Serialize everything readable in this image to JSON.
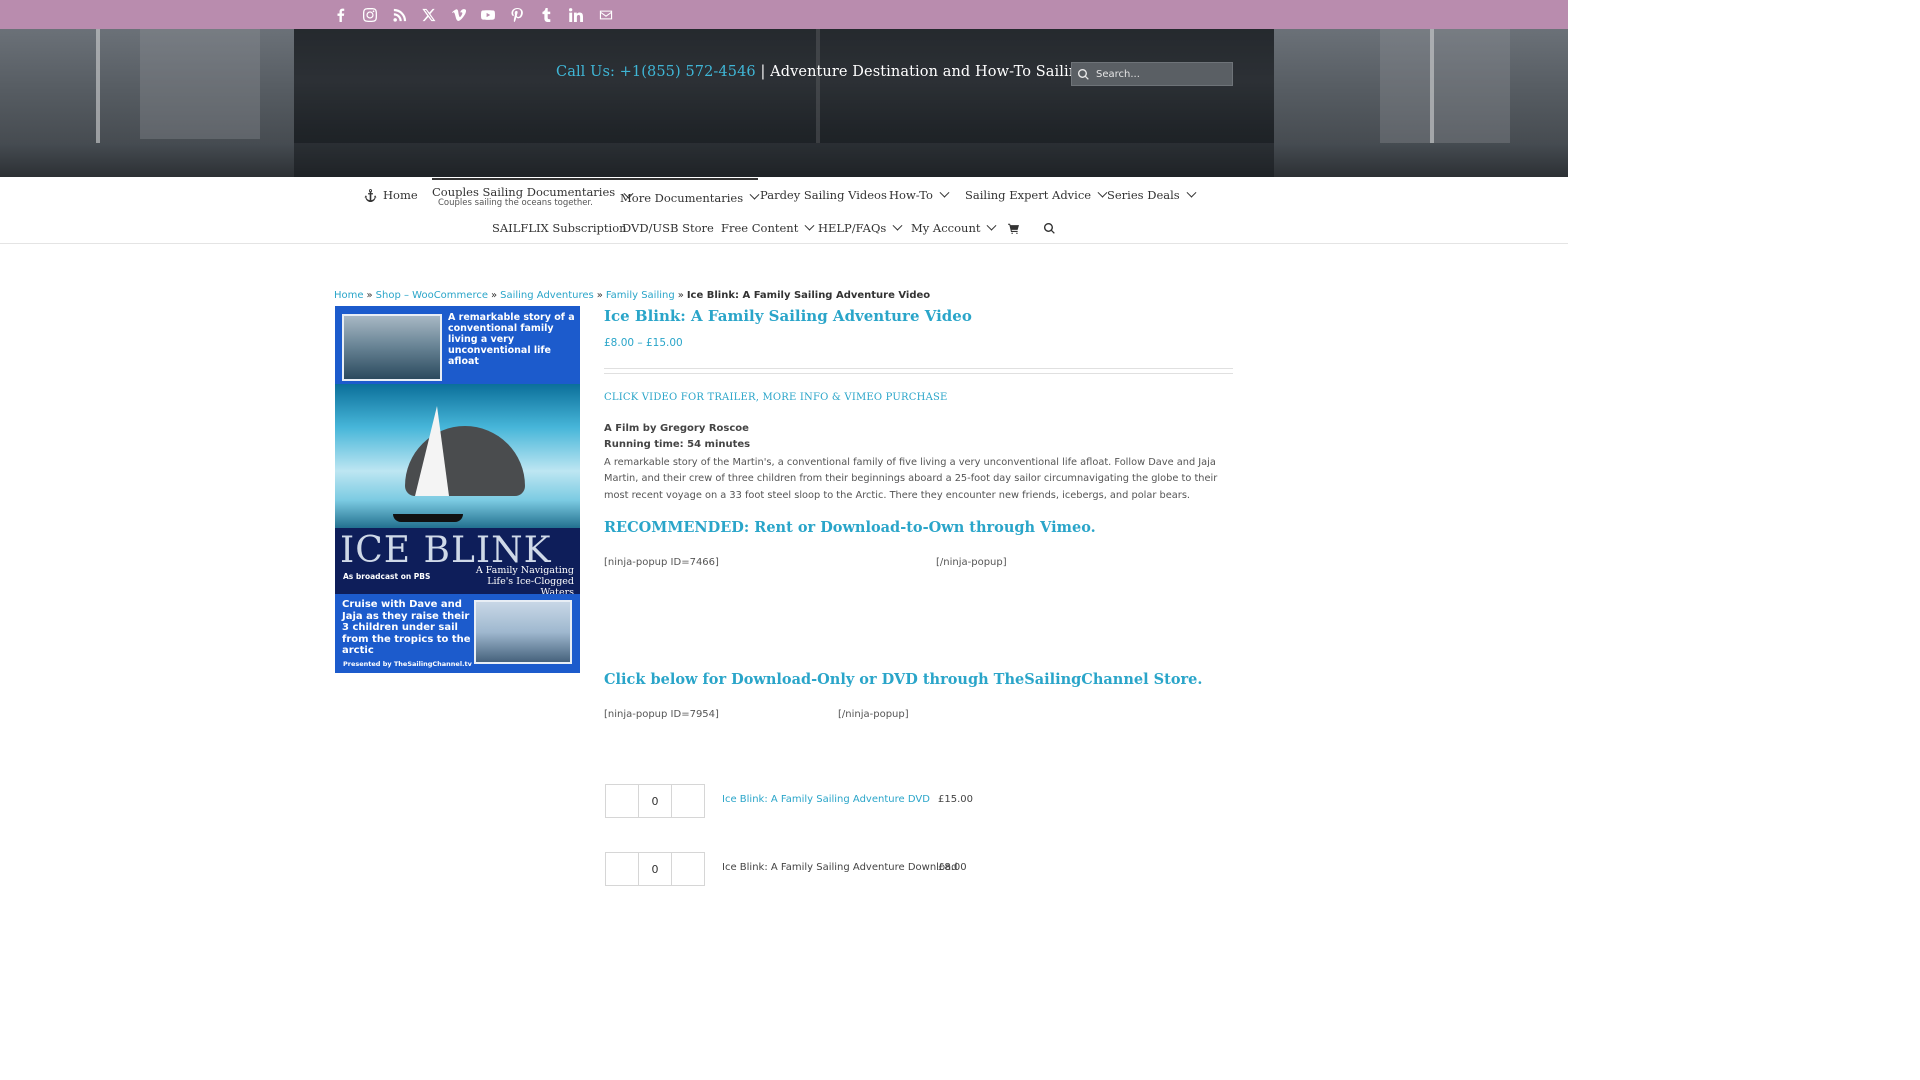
{
  "social": [
    "facebook-icon",
    "instagram-icon",
    "rss-icon",
    "x-twitter-icon",
    "vimeo-icon",
    "youtube-icon",
    "pinterest-icon",
    "tumblr-icon",
    "linkedin-icon",
    "email-icon"
  ],
  "header": {
    "call_label": "Call Us: +1(855) 572-4546",
    "tagline": " | Adventure Destination and How-To Sailing Videos",
    "search_placeholder": "Search..."
  },
  "nav": {
    "home": "Home",
    "couples": "Couples Sailing Documentaries",
    "couples_sub": "Couples sailing the oceans together.",
    "more_docs": "More Documentaries",
    "pardey": "Pardey Sailing Videos",
    "howto": "How-To",
    "expert": "Sailing Expert Advice",
    "series": "Series Deals",
    "sailflix": "SAILFLIX Subscription",
    "dvd": "DVD/USB Store",
    "free": "Free Content",
    "help": "HELP/FAQs",
    "account": "My Account"
  },
  "breadcrumb": {
    "home": "Home",
    "shop": "Shop – WooCommerce",
    "adventures": "Sailing Adventures",
    "family": "Family Sailing",
    "current": "Ice Blink: A Family Sailing Adventure Video",
    "separator": "»"
  },
  "cover": {
    "top_text": "A remarkable story of a conventional family living a very unconventional life afloat",
    "title": "ICE BLINK",
    "broadcast": "As broadcast on PBS",
    "subtitle": "A Family Navigating Life's Ice-Clogged Waters",
    "bottom_text": "Cruise with Dave and Jaja as they raise their 3 children under sail from the tropics to the arctic",
    "presented": "Presented by TheSailingChannel.tv"
  },
  "product": {
    "title": "Ice Blink: A Family Sailing Adventure Video",
    "price": "£8.00 – £15.00",
    "click_video": "CLICK VIDEO FOR TRAILER, MORE INFO & VIMEO PURCHASE",
    "film_by": "A Film by Gregory Roscoe",
    "running_time": "Running time: 54 minutes",
    "description": "A remarkable story of the Martin's, a conventional family of five living a very unconventional life afloat. Follow Dave and Jaja Martin, and their crew of three children from their beginnings aboard a 25-foot day sailor circumnavigating the globe to their most recent voyage on a 33 foot steel sloop to the Arctic. There they encounter new friends, icebergs, and polar bears.",
    "recommended": "RECOMMENDED: Rent or Download-to-Own through Vimeo.",
    "popup1_open": "[ninja-popup ID=7466]",
    "popup1_close": "[/ninja-popup]",
    "download_heading": "Click below for Download-Only or DVD through TheSailingChannel Store.",
    "popup2_open": "[ninja-popup ID=7954]",
    "popup2_close": "[/ninja-popup]"
  },
  "grouped": [
    {
      "qty": "0",
      "name": "Ice Blink: A Family Sailing Adventure DVD",
      "price": "£15.00"
    },
    {
      "qty": "0",
      "name": "Ice Blink: A Family Sailing Adventure Download",
      "price": "£8.00"
    }
  ],
  "colors": {
    "topbar": "#b98cae",
    "accent": "#2aa5c9",
    "text": "#333333"
  }
}
